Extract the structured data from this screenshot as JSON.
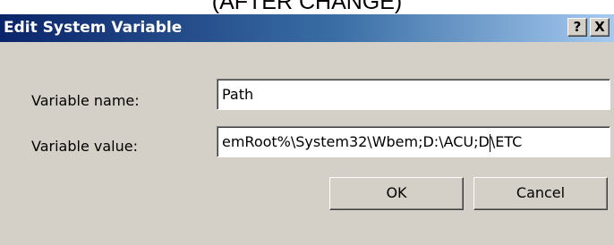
{
  "caption": "(AFTER CHANGE)",
  "dialog": {
    "title": "Edit System Variable",
    "help_label": "?",
    "close_label": "X"
  },
  "form": {
    "name_label": "Variable name:",
    "name_value": "Path",
    "value_label": "Variable value:",
    "value_before_caret": "emRoot%\\System32\\Wbem;D:\\ACU;D",
    "value_after_caret": "\\ETC"
  },
  "buttons": {
    "ok_label": "OK",
    "cancel_label": "Cancel"
  }
}
